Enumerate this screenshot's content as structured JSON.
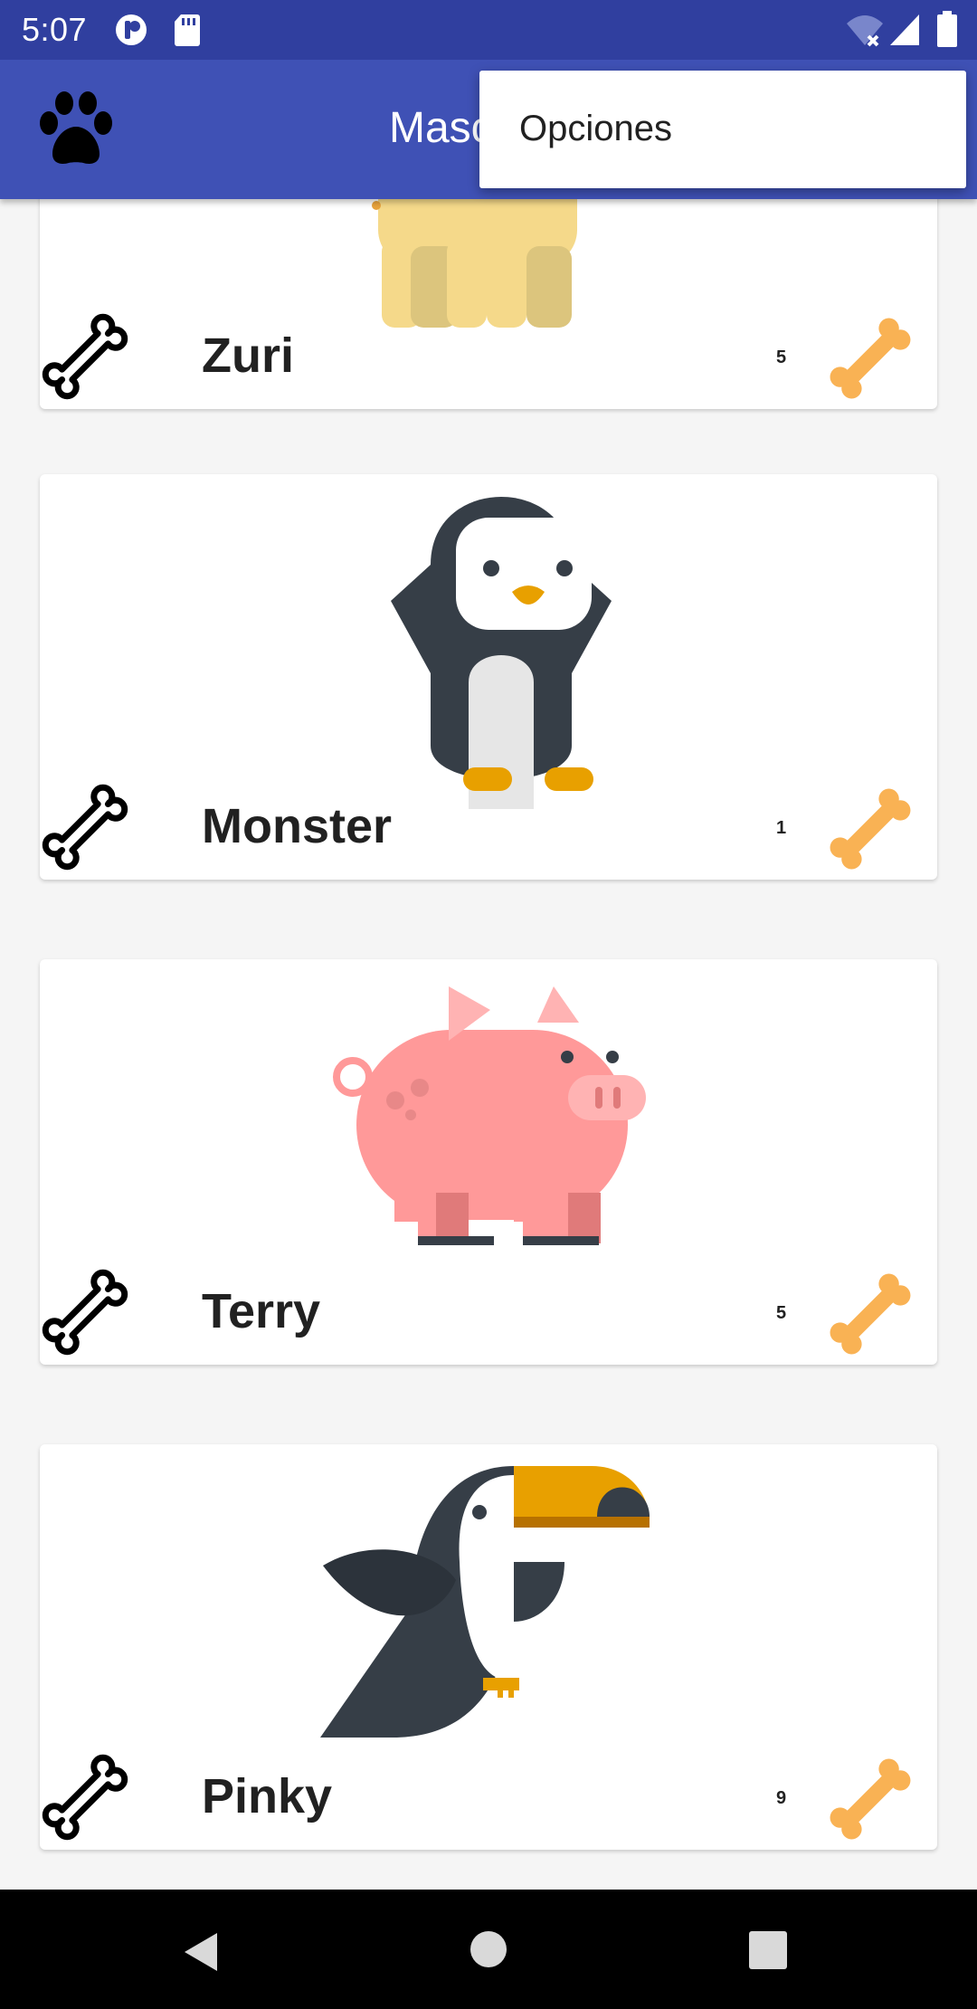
{
  "status_bar": {
    "time": "5:07"
  },
  "app_bar": {
    "title": "Mascotas",
    "menu_icon": "paw-icon"
  },
  "overflow_menu": {
    "items": [
      {
        "label": "Opciones"
      }
    ]
  },
  "pets": [
    {
      "name": "Zuri",
      "likes": "5",
      "animal": "dog"
    },
    {
      "name": "Monster",
      "likes": "1",
      "animal": "penguin"
    },
    {
      "name": "Terry",
      "likes": "5",
      "animal": "pig"
    },
    {
      "name": "Pinky",
      "likes": "9",
      "animal": "toucan"
    }
  ],
  "colors": {
    "primary": "#3f51b5",
    "primary_dark": "#303f9f",
    "bone_accent": "#f9b254"
  }
}
